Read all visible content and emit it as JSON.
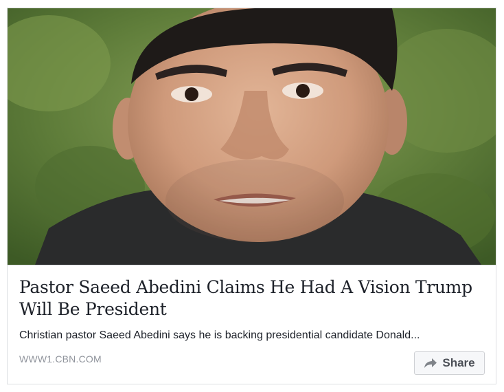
{
  "post": {
    "image_alt": "Portrait photo of a man in front of green foliage",
    "headline": "Pastor Saeed Abedini Claims He Had A Vision Trump Will Be President",
    "description": "Christian pastor Saeed Abedini says he is backing presidential candidate Donald...",
    "domain": "WWW1.CBN.COM",
    "share_label": "Share",
    "share_icon": "share-arrow-icon"
  },
  "colors": {
    "border": "#dddfe2",
    "headline_text": "#1d2129",
    "domain_text": "#90949c",
    "button_bg": "#f6f7f9",
    "button_text": "#4b4f56"
  }
}
